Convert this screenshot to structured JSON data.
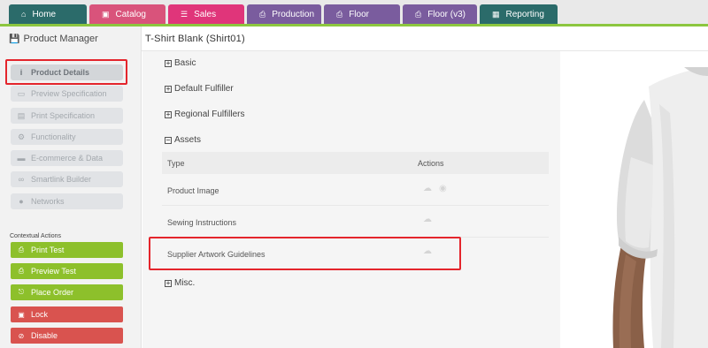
{
  "nav": {
    "tabs": [
      {
        "label": "Home",
        "color": "#2b6b6a",
        "icon": "home-icon"
      },
      {
        "label": "Catalog",
        "color": "#d9537b",
        "icon": "catalog-icon"
      },
      {
        "label": "Sales",
        "color": "#e0357a",
        "icon": "list-icon"
      },
      {
        "label": "Production",
        "color": "#7a5c9e",
        "icon": "printer-icon"
      },
      {
        "label": "Floor",
        "color": "#7a5c9e",
        "icon": "printer-icon"
      },
      {
        "label": "Floor (v3)",
        "color": "#7a5c9e",
        "icon": "printer-icon"
      },
      {
        "label": "Reporting",
        "color": "#2b6b6a",
        "icon": "table-icon"
      }
    ]
  },
  "sidebar": {
    "title": "Product Manager",
    "items": [
      {
        "label": "Product Details",
        "icon": "info-icon"
      },
      {
        "label": "Preview Specification",
        "icon": "monitor-icon"
      },
      {
        "label": "Print Specification",
        "icon": "document-icon"
      },
      {
        "label": "Functionality",
        "icon": "gears-icon"
      },
      {
        "label": "E-commerce & Data",
        "icon": "card-icon"
      },
      {
        "label": "Smartlink Builder",
        "icon": "link-icon"
      },
      {
        "label": "Networks",
        "icon": "globe-icon"
      }
    ],
    "contextual_label": "Contextual Actions",
    "actions": [
      {
        "label": "Print Test",
        "icon": "printer-icon",
        "color": "#8dc02b"
      },
      {
        "label": "Preview Test",
        "icon": "printer-icon",
        "color": "#8dc02b"
      },
      {
        "label": "Place Order",
        "icon": "cart-icon",
        "color": "#8dc02b"
      },
      {
        "label": "Lock",
        "icon": "lock-icon",
        "color": "#d9534f"
      },
      {
        "label": "Disable",
        "icon": "ban-icon",
        "color": "#d9534f"
      }
    ]
  },
  "main": {
    "title": "T-Shirt Blank (Shirt01)",
    "sections": {
      "basic": "Basic",
      "default_fulfiller": "Default Fulfiller",
      "regional_fulfillers": "Regional Fulfillers",
      "assets": "Assets",
      "misc": "Misc."
    },
    "assets_table": {
      "headers": {
        "type": "Type",
        "actions": "Actions"
      },
      "rows": [
        {
          "type": "Product Image",
          "actions": [
            "upload-icon",
            "eye-icon"
          ]
        },
        {
          "type": "Sewing Instructions",
          "actions": [
            "upload-icon"
          ]
        },
        {
          "type": "Supplier Artwork Guidelines",
          "actions": [
            "upload-icon"
          ]
        }
      ]
    }
  },
  "colors": {
    "accent_green": "#8cc63f",
    "highlight_red": "#e4252c"
  }
}
